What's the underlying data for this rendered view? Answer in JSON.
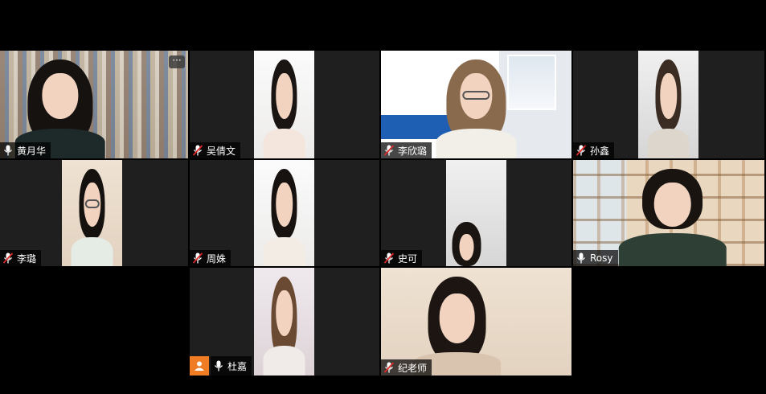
{
  "participants": [
    {
      "name": "黄月华",
      "muted": false
    },
    {
      "name": "吴倩文",
      "muted": true
    },
    {
      "name": "李欣璐",
      "muted": true
    },
    {
      "name": "孙鑫",
      "muted": true
    },
    {
      "name": "李璐",
      "muted": true
    },
    {
      "name": "周姝",
      "muted": true
    },
    {
      "name": "史可",
      "muted": true
    },
    {
      "name": "Rosy",
      "muted": false
    },
    {
      "name": "杜嘉",
      "muted": false
    },
    {
      "name": "纪老师",
      "muted": true
    }
  ],
  "more_button_label": "···",
  "icons": {
    "mic": "microphone-icon",
    "mic_muted": "microphone-muted-icon",
    "more": "ellipsis-icon",
    "avatar": "user-avatar-icon"
  },
  "colors": {
    "tile_bg": "#1f1f1f",
    "muted_red": "#e02828",
    "avatar_orange": "#f07c23"
  }
}
